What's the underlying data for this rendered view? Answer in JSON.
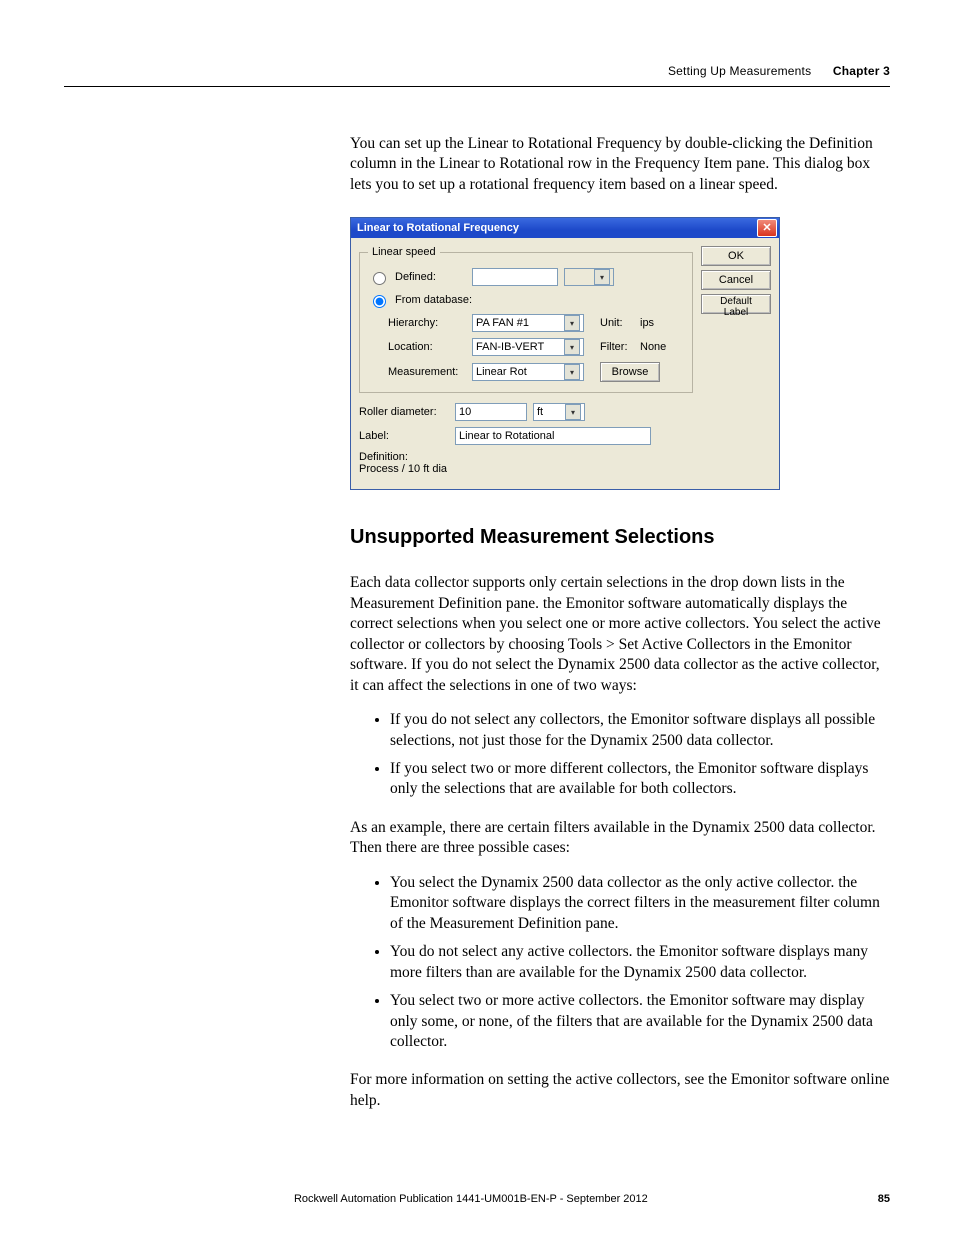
{
  "header": {
    "section": "Setting Up Measurements",
    "chapter": "Chapter 3"
  },
  "intro": "You can set up the Linear to Rotational Frequency by double-clicking the Definition column in the Linear to Rotational row in the Frequency Item pane. This dialog box lets you to set up a rotational frequency item based on a linear speed.",
  "dialog": {
    "title": "Linear to Rotational Frequency",
    "group_legend": "Linear speed",
    "radio_defined": "Defined:",
    "radio_fromdb": "From database:",
    "labels": {
      "hierarchy": "Hierarchy:",
      "location": "Location:",
      "measurement": "Measurement:",
      "unit": "Unit:",
      "filter": "Filter:",
      "roller": "Roller diameter:",
      "label": "Label:",
      "definition": "Definition:"
    },
    "values": {
      "hierarchy": "PA FAN #1",
      "location": "FAN-IB-VERT",
      "measurement": "Linear Rot",
      "unit": "ips",
      "filter": "None",
      "roller": "10",
      "roller_unit": "ft",
      "label": "Linear to Rotational",
      "definition": "Process / 10 ft dia"
    },
    "buttons": {
      "ok": "OK",
      "cancel": "Cancel",
      "default": "Default Label",
      "browse": "Browse"
    }
  },
  "section_heading": "Unsupported Measurement Selections",
  "p1": "Each data collector supports only certain selections in the drop down lists in the Measurement Definition pane. the Emonitor software automatically displays the correct selections when you select one or more active collectors. You select the active collector or collectors by choosing Tools > Set Active Collectors in the Emonitor software. If you do not select the Dynamix 2500 data collector as the active collector, it can affect the selections in one of two ways:",
  "list1": [
    "If you do not select any collectors, the Emonitor software displays all possible selections, not just those for the Dynamix 2500 data collector.",
    "If you select two or more different collectors, the Emonitor software displays only the selections that are available for both collectors."
  ],
  "p2": "As an example, there are certain filters available in the Dynamix 2500 data collector. Then there are three possible cases:",
  "list2": [
    "You select the Dynamix 2500 data collector as the only active collector. the Emonitor software displays the correct filters in the measurement filter column of the Measurement Definition pane.",
    "You do not select any active collectors. the Emonitor software displays many more filters than are available for the Dynamix 2500 data collector.",
    "You select two or more active collectors. the Emonitor software may display only some, or none, of the filters that are available for the Dynamix 2500 data collector."
  ],
  "p3": "For more information on setting the active collectors, see the Emonitor software online help.",
  "footer": {
    "pub": "Rockwell Automation Publication 1441-UM001B-EN-P - September 2012",
    "page": "85"
  }
}
